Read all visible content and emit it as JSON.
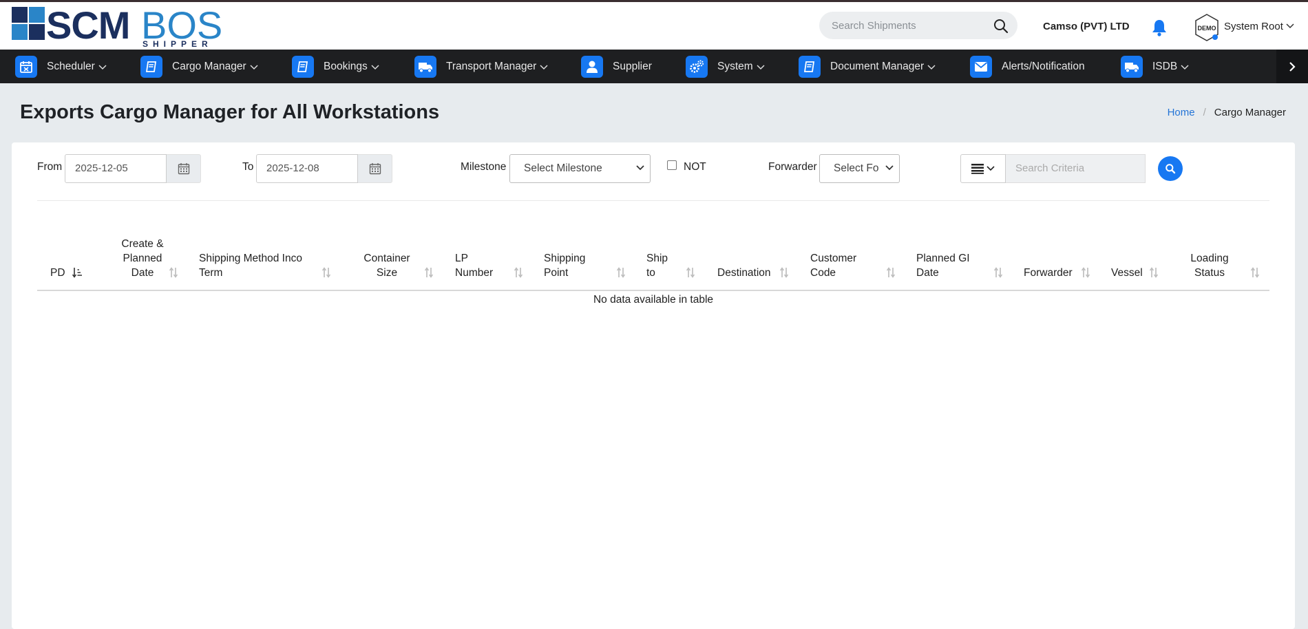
{
  "brand": {
    "name_a": "SCM",
    "name_b": "BOS",
    "sub": "SHIPPER"
  },
  "header": {
    "search_placeholder": "Search Shipments",
    "company": "Camso (PVT) LTD",
    "avatar_text": "DEMO",
    "user": "System Root"
  },
  "nav": [
    {
      "label": "Scheduler",
      "icon": "calendar-icon",
      "dropdown": true
    },
    {
      "label": "Cargo Manager",
      "icon": "book-icon",
      "dropdown": true
    },
    {
      "label": "Bookings",
      "icon": "book-icon",
      "dropdown": true
    },
    {
      "label": "Transport Manager",
      "icon": "truck-icon",
      "dropdown": true
    },
    {
      "label": "Supplier",
      "icon": "user-icon",
      "dropdown": false
    },
    {
      "label": "System",
      "icon": "cogs-icon",
      "dropdown": true
    },
    {
      "label": "Document Manager",
      "icon": "book-icon",
      "dropdown": true
    },
    {
      "label": "Alerts/Notification",
      "icon": "envelope-icon",
      "dropdown": false
    },
    {
      "label": "ISDB",
      "icon": "truck-icon",
      "dropdown": true
    }
  ],
  "page": {
    "title": "Exports Cargo Manager for All Workstations",
    "breadcrumb": {
      "home": "Home",
      "current": "Cargo Manager"
    }
  },
  "filters": {
    "from_label": "From",
    "from_value": "2025-12-05",
    "to_label": "To",
    "to_value": "2025-12-08",
    "milestone_label": "Milestone",
    "milestone_value": "Select Milestone",
    "not_label": "NOT",
    "forwarder_label": "Forwarder",
    "forwarder_value": "Select Fo",
    "criteria_placeholder": "Search Criteria"
  },
  "table": {
    "columns": [
      "PD",
      "Create & Planned Date",
      "Shipping Method Inco Term",
      "Container Size",
      "LP Number",
      "Shipping Point",
      "Ship to",
      "Destination",
      "Customer Code",
      "Planned GI Date",
      "Forwarder",
      "Vessel",
      "Loading Status"
    ],
    "col_lines": [
      [
        "PD"
      ],
      [
        "Create &",
        "Planned",
        "Date"
      ],
      [
        "Shipping Method Inco",
        "Term"
      ],
      [
        "Container",
        "Size"
      ],
      [
        "LP",
        "Number"
      ],
      [
        "Shipping",
        "Point"
      ],
      [
        "Ship",
        "to"
      ],
      [
        "Destination"
      ],
      [
        "Customer",
        "Code"
      ],
      [
        "Planned GI",
        "Date"
      ],
      [
        "Forwarder"
      ],
      [
        "Vessel"
      ],
      [
        "Loading",
        "Status"
      ]
    ],
    "empty_message": "No data available in table"
  },
  "colors": {
    "nav_bg": "#1e1f21",
    "accent": "#1778f2",
    "brand_dark": "#1b2f5e",
    "brand_light": "#2a85c8",
    "page_bg": "#e7ebee"
  }
}
